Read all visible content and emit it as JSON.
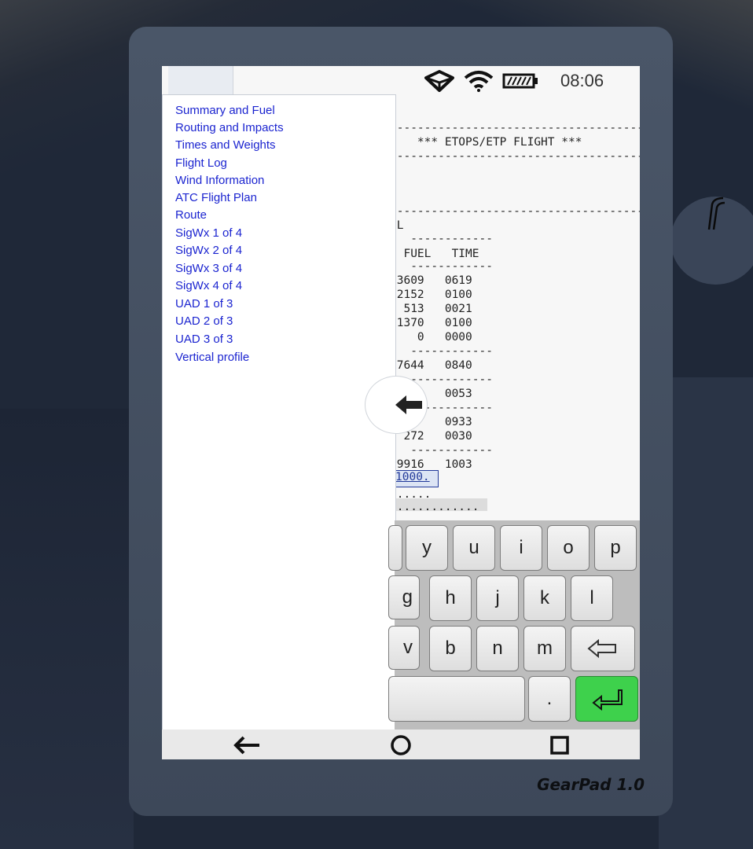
{
  "device": {
    "brand": "GearPad 1.0"
  },
  "status": {
    "time": "08:06",
    "icons": [
      "cube-icon",
      "wifi-icon",
      "battery-icon"
    ]
  },
  "document": {
    "lines": [
      "/",
      "------------------------------------------",
      "    *** ETOPS/ETP FLIGHT ***",
      "------------------------------------------",
      "------------------------------------------",
      "EL",
      "   ------------",
      "  FUEL   TIME",
      "   ------------",
      "13609   0619",
      " 2152   0100",
      "  513   0021",
      " 1370   0100",
      "    0   0000",
      "   ------------",
      "17644   0840",
      "   ------------",
      "  90    0053",
      "   ------------",
      " 344    0933",
      "  272   0030",
      "   ------------",
      "19916   1003",
      " .....",
      " ............"
    ],
    "highlight_text": "1000."
  },
  "menu": {
    "items": [
      "Summary and Fuel",
      "Routing and Impacts",
      "Times and Weights",
      "Flight Log",
      "Wind Information",
      "ATC Flight Plan",
      "Route",
      "SigWx 1 of 4",
      "SigWx 2 of 4",
      "SigWx 3 of 4",
      "SigWx 4 of 4",
      "UAD 1 of 3",
      "UAD 2 of 3",
      "UAD 3 of 3",
      "Vertical profile"
    ]
  },
  "keyboard": {
    "row1": [
      "y",
      "u",
      "i",
      "o",
      "p"
    ],
    "row2": [
      "g",
      "h",
      "j",
      "k",
      "l"
    ],
    "row3": [
      "v",
      "b",
      "n",
      "m"
    ],
    "dot": ".",
    "backspace_icon": "backspace-arrow-icon",
    "enter_icon": "enter-icon"
  },
  "navbar": {
    "icons": [
      "back-arrow-icon",
      "home-circle-icon",
      "recents-square-icon"
    ]
  },
  "colors": {
    "menu_link": "#1b24d0",
    "enter_key": "#3ed14c",
    "device_frame": "#434f61"
  }
}
